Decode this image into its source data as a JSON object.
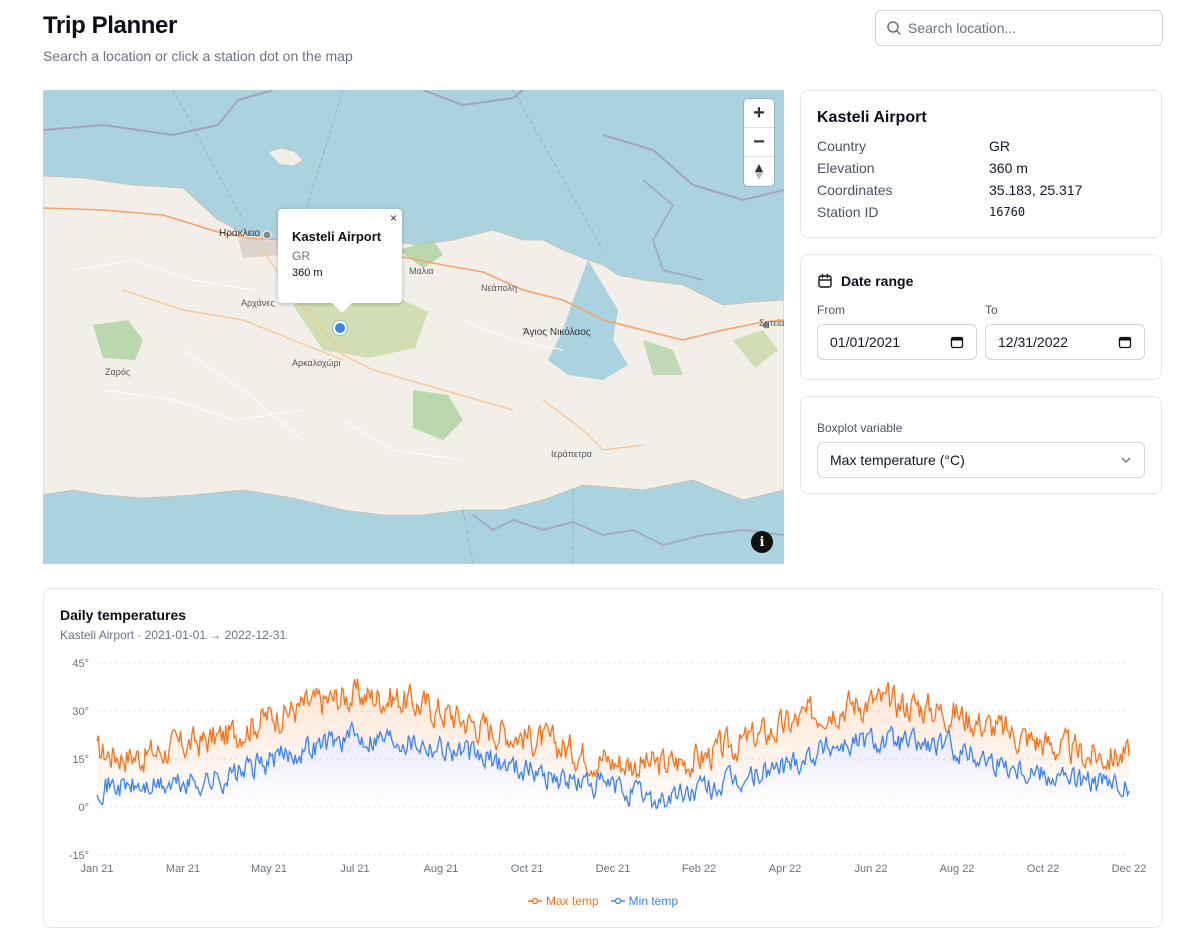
{
  "header": {
    "title": "Trip Planner",
    "subtitle": "Search a location or click a station dot on the map"
  },
  "search": {
    "placeholder": "Search location..."
  },
  "map": {
    "labels": [
      "Ηράκλειο",
      "Μαλια",
      "Νεάπολη",
      "Άγιος Νικόλαος",
      "Αρχάνες",
      "Ζαρός",
      "Αρκαλοχώρι",
      "Ιεράπετρα",
      "Σητεία"
    ],
    "popup": {
      "close": "×",
      "name": "Kasteli Airport",
      "country": "GR",
      "elevation": "360 m"
    },
    "zoom_in": "+",
    "zoom_out": "−",
    "info": "i",
    "colors": {
      "sea": "#aad3df",
      "land": "#f2efe9",
      "forest": "#add19e",
      "road": "#f5a26b",
      "border": "#9e8fb0"
    }
  },
  "station": {
    "name": "Kasteli Airport",
    "rows": [
      {
        "key": "Country",
        "value": "GR"
      },
      {
        "key": "Elevation",
        "value": "360 m"
      },
      {
        "key": "Coordinates",
        "value": "35.183, 25.317"
      },
      {
        "key": "Station ID",
        "value": "16760"
      }
    ]
  },
  "date_range": {
    "title": "Date range",
    "from_label": "From",
    "from_value": "01/01/2021",
    "to_label": "To",
    "to_value": "12/31/2022"
  },
  "boxplot": {
    "label": "Boxplot variable",
    "selected": "Max temperature (°C)"
  },
  "chart": {
    "title": "Daily temperatures",
    "subtitle": "Kasteli Airport · 2021-01-01 → 2022-12-31"
  },
  "chart_data": {
    "type": "line",
    "title": "Daily temperatures",
    "subtitle": "Kasteli Airport · 2021-01-01 → 2022-12-31",
    "xlabel": "",
    "ylabel": "",
    "ylim": [
      -15,
      45
    ],
    "yticks": [
      "45°",
      "30°",
      "15°",
      "0°",
      "-15°"
    ],
    "ytick_values": [
      45,
      30,
      15,
      0,
      -15
    ],
    "xticks": [
      "Jan 21",
      "Mar 21",
      "May 21",
      "Jul 21",
      "Aug 21",
      "Oct 21",
      "Dec 21",
      "Feb 22",
      "Apr 22",
      "Jun 22",
      "Aug 22",
      "Oct 22",
      "Dec 22"
    ],
    "x_dates": [
      "2021-01-01",
      "2021-02-01",
      "2021-03-01",
      "2021-04-01",
      "2021-05-01",
      "2021-06-01",
      "2021-07-01",
      "2021-08-01",
      "2021-09-01",
      "2021-10-01",
      "2021-11-01",
      "2021-12-01",
      "2022-01-01",
      "2022-02-01",
      "2022-03-01",
      "2022-04-01",
      "2022-05-01",
      "2022-06-01",
      "2022-07-01",
      "2022-08-01",
      "2022-09-01",
      "2022-10-01",
      "2022-11-01",
      "2022-12-01",
      "2022-12-31"
    ],
    "grid": true,
    "legend_position": "bottom",
    "series": [
      {
        "name": "Max temp",
        "color": "#f97316",
        "values": [
          17,
          16,
          19,
          22,
          28,
          32,
          35,
          34,
          30,
          25,
          22,
          18,
          14,
          13,
          15,
          20,
          25,
          31,
          33,
          32,
          29,
          24,
          20,
          16,
          16
        ]
      },
      {
        "name": "Min temp",
        "color": "#3b82f6",
        "values": [
          7,
          6,
          7,
          9,
          14,
          19,
          22,
          22,
          19,
          15,
          12,
          8,
          6,
          2,
          5,
          8,
          13,
          19,
          21,
          20,
          18,
          14,
          11,
          8,
          5
        ]
      }
    ]
  }
}
